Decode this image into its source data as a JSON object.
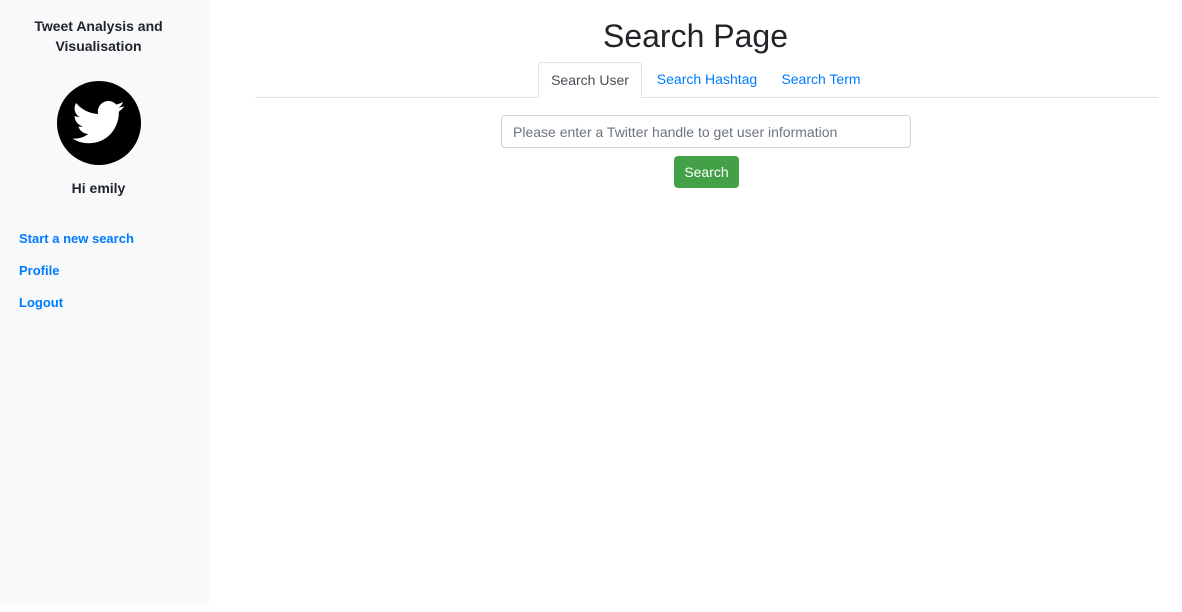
{
  "sidebar": {
    "brand": "Tweet Analysis and Visualisation",
    "logo_icon": "twitter-bird-icon",
    "greeting": "Hi emily",
    "nav": [
      {
        "label": "Start a new search"
      },
      {
        "label": "Profile"
      },
      {
        "label": "Logout"
      }
    ]
  },
  "main": {
    "title": "Search Page",
    "tabs": [
      {
        "label": "Search User",
        "active": true
      },
      {
        "label": "Search Hashtag",
        "active": false
      },
      {
        "label": "Search Term",
        "active": false
      }
    ],
    "search": {
      "value": "",
      "placeholder": "Please enter a Twitter handle to get user information",
      "button_label": "Search"
    }
  },
  "colors": {
    "sidebar_bg": "#f8f9fa",
    "link": "#007bff",
    "search_button": "#43a047"
  }
}
